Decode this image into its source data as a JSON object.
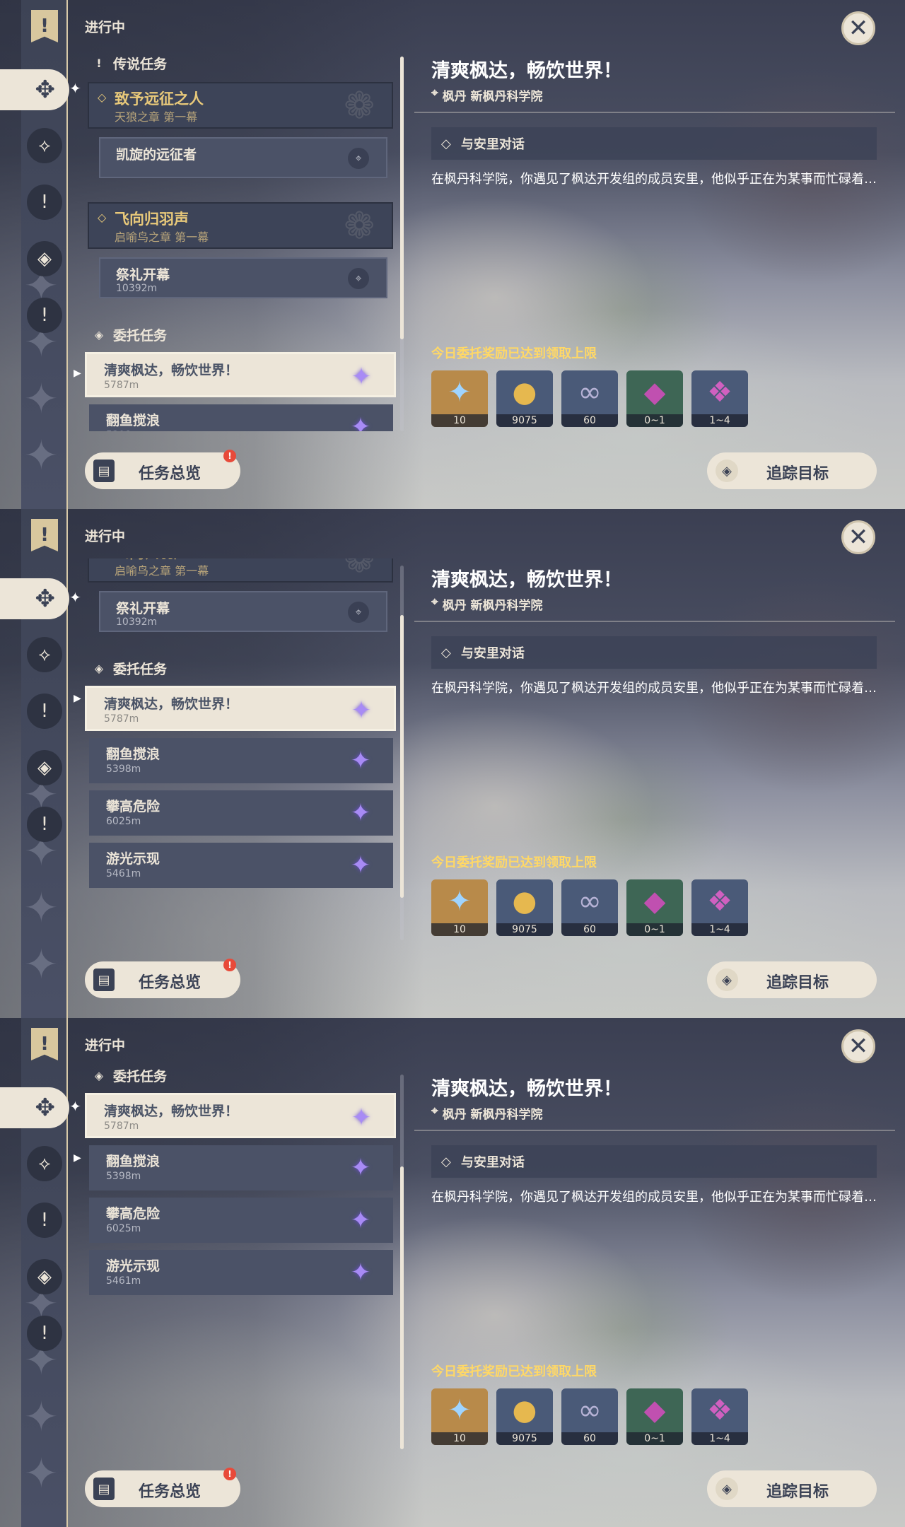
{
  "status_title": "进行中",
  "close_icon": "✕",
  "sidebar": {
    "top_icon": "!",
    "active_icon": "✥",
    "spark": "✦",
    "items": [
      {
        "name": "archon-quest-icon",
        "glyph": "⟡"
      },
      {
        "name": "story-quest-icon",
        "glyph": "!"
      },
      {
        "name": "commission-quest-icon",
        "glyph": "◈"
      },
      {
        "name": "world-quest-icon",
        "glyph": "!"
      }
    ]
  },
  "categories": {
    "legend": "传说任务",
    "commission": "委托任务"
  },
  "chapters": [
    {
      "title": "致予远征之人",
      "subtitle": "天狼之章 第一幕",
      "quest": "凯旋的远征者",
      "dist": ""
    },
    {
      "title": "飞向归羽声",
      "subtitle": "启喻鸟之章 第一幕",
      "quest": "祭礼开幕",
      "dist": "10392m"
    }
  ],
  "commissions": [
    {
      "title": "清爽枫达，畅饮世界！",
      "dist": "5787m"
    },
    {
      "title": "翻鱼搅浪",
      "dist": "5398m"
    },
    {
      "title": "攀高危险",
      "dist": "6025m"
    },
    {
      "title": "游光示现",
      "dist": "5461m"
    }
  ],
  "detail": {
    "title": "清爽枫达，畅饮世界！",
    "location": "枫丹 新枫丹科学院",
    "objective": "与安里对话",
    "description": "在枫丹科学院，你遇见了枫达开发组的成员安里，他似乎正在为某事而忙碌着…",
    "limit_notice": "今日委托奖励已达到领取上限",
    "rewards": [
      {
        "name": "primogem-icon",
        "glyph": "✦",
        "count": "10",
        "bg": "#b88a4a",
        "color": "#9fd4ff"
      },
      {
        "name": "mora-icon",
        "glyph": "●",
        "count": "9075",
        "bg": "#4a5a78",
        "color": "#e6b84f"
      },
      {
        "name": "companionship-exp-icon",
        "glyph": "∞",
        "count": "60",
        "bg": "#4a5a78",
        "color": "#b7b3d6"
      },
      {
        "name": "crystal-icon",
        "glyph": "◆",
        "count": "0~1",
        "bg": "#3e6655",
        "color": "#c050b0"
      },
      {
        "name": "crystal-chunk-icon",
        "glyph": "❖",
        "count": "1~4",
        "bg": "#4a5a78",
        "color": "#d060c0"
      }
    ]
  },
  "buttons": {
    "overview": "任务总览",
    "overview_badge": "!",
    "track": "追踪目标",
    "track_icon": "◈"
  },
  "icons": {
    "legend": "!",
    "chapter": "◇",
    "commission": "◈",
    "pin": "⌖",
    "star": "✦",
    "arrow": "▶",
    "location": "⌖",
    "objective": "◇",
    "doc": "▤",
    "emblem": "❁"
  },
  "colors": {
    "accent_gold": "#e8c97a",
    "limit_yellow": "#ffd866",
    "panel_cream": "#ece5d8",
    "badge_red": "#e84a3a"
  }
}
